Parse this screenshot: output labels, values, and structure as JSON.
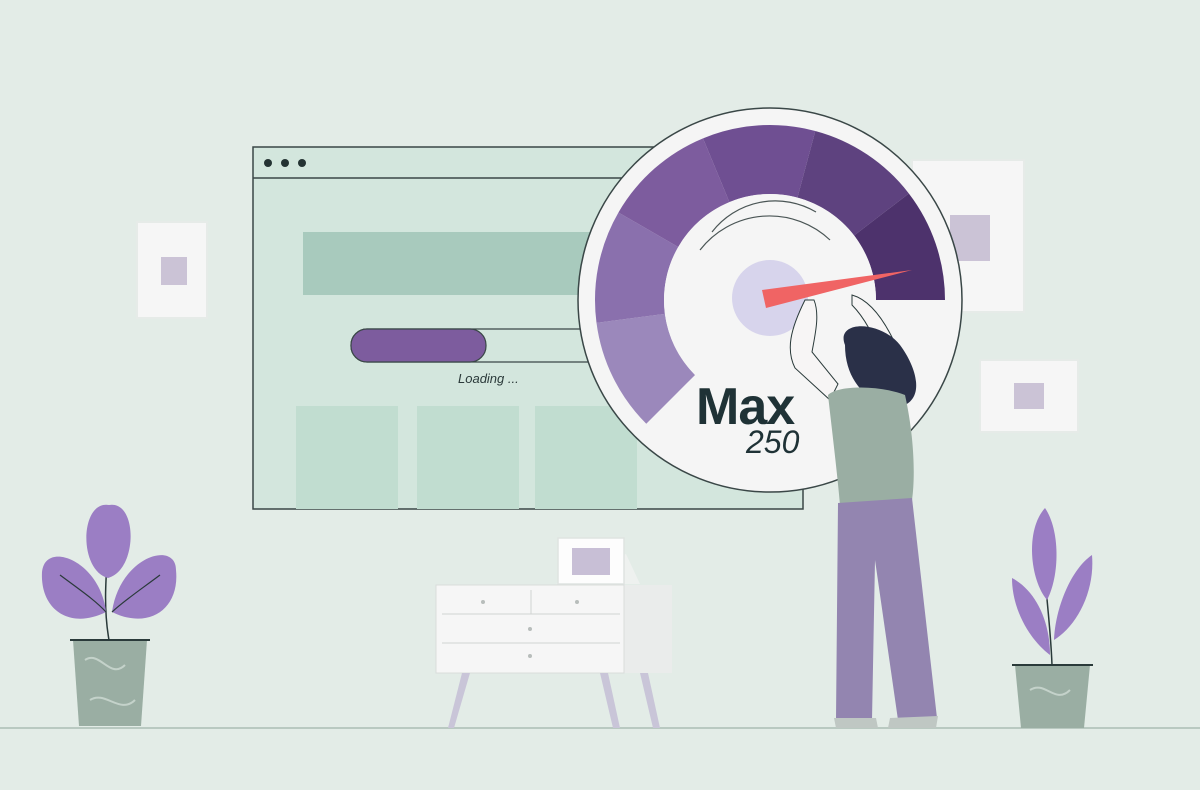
{
  "browser": {
    "loading_text": "Loading ...",
    "loading_progress_percent": 45
  },
  "gauge": {
    "label": "Max",
    "value": "250"
  },
  "colors": {
    "background": "#e3ece7",
    "browser_fill": "#d3e6dd",
    "purple_dark": "#5b3f7e",
    "purple_mid": "#7d5c9e",
    "purple_light": "#9b88bb",
    "needle": "#f06464",
    "plant_leaf": "#9b7ec4",
    "pot": "#9aaea3"
  }
}
